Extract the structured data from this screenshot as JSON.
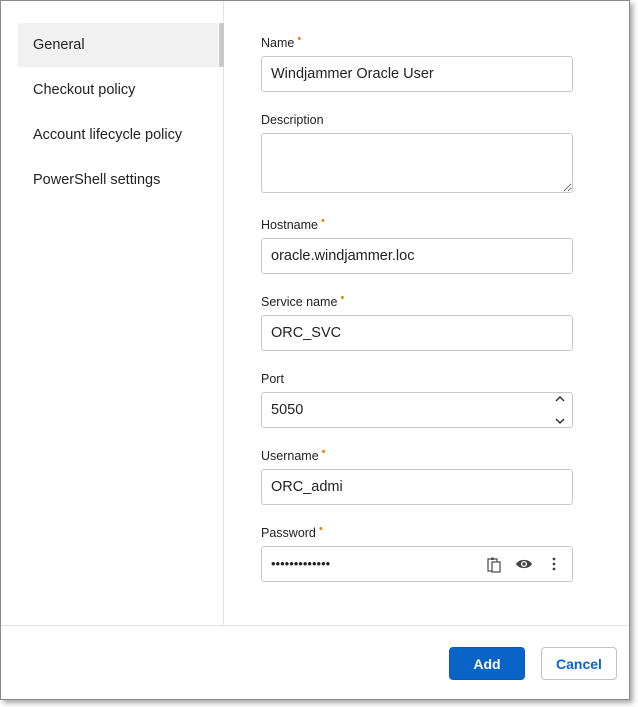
{
  "sidebar": {
    "items": [
      {
        "label": "General",
        "active": true
      },
      {
        "label": "Checkout policy"
      },
      {
        "label": "Account lifecycle policy"
      },
      {
        "label": "PowerShell settings"
      }
    ]
  },
  "form": {
    "name": {
      "label": "Name",
      "value": "Windjammer Oracle User",
      "required": true
    },
    "description": {
      "label": "Description",
      "value": ""
    },
    "hostname": {
      "label": "Hostname",
      "value": "oracle.windjammer.loc",
      "required": true
    },
    "service_name": {
      "label": "Service name",
      "value": "ORC_SVC",
      "required": true
    },
    "port": {
      "label": "Port",
      "value": "5050"
    },
    "username": {
      "label": "Username",
      "value": "ORC_admi",
      "required": true
    },
    "password": {
      "label": "Password",
      "value": "•••••••••••••",
      "required": true
    },
    "required_marker": "•"
  },
  "footer": {
    "add_label": "Add",
    "cancel_label": "Cancel"
  },
  "colors": {
    "primary": "#0a64c8",
    "required": "#f07d00"
  },
  "icons": [
    "chevron-up-icon",
    "chevron-down-icon",
    "clipboard-icon",
    "eye-icon",
    "more-vertical-icon"
  ]
}
